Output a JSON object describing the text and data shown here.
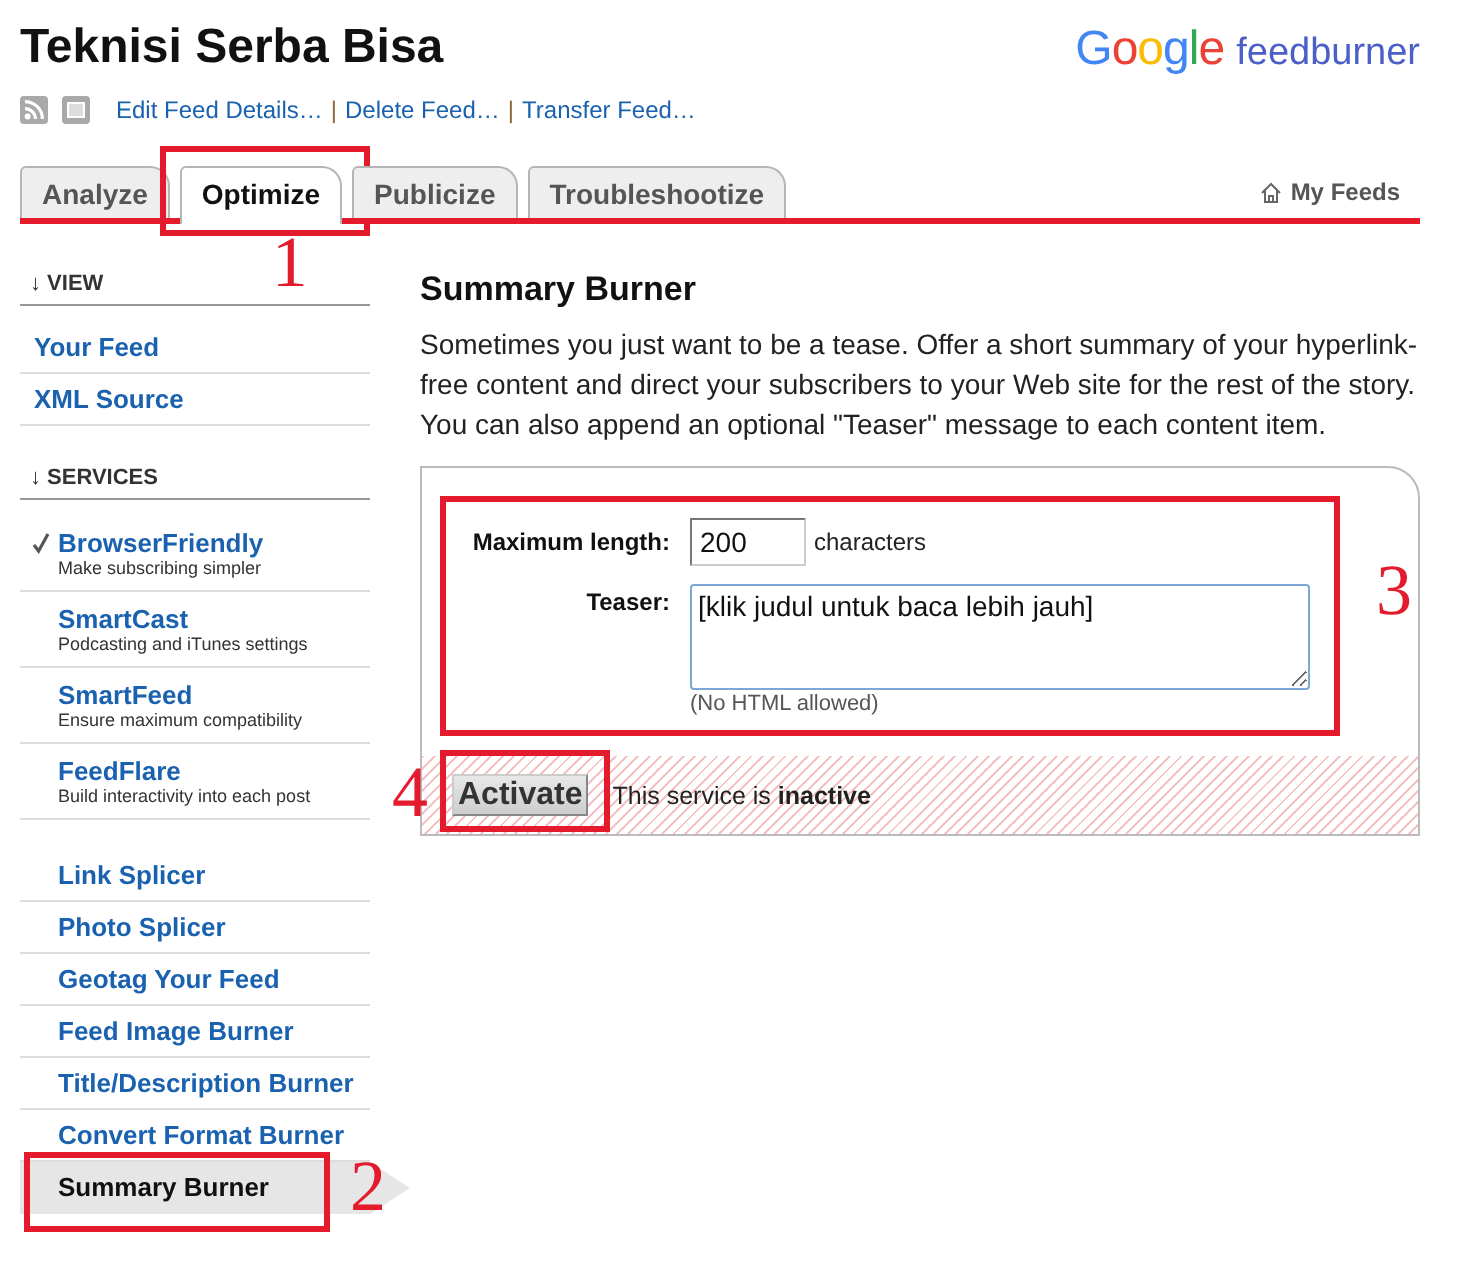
{
  "header": {
    "title": "Teknisi Serba Bisa",
    "logo": {
      "brand": "Google",
      "product": "feedburner"
    },
    "feed_links": [
      {
        "kind": "link",
        "text": "Edit Feed Details…"
      },
      {
        "kind": "separator",
        "text": "|"
      },
      {
        "kind": "link",
        "text": "Delete Feed…"
      },
      {
        "kind": "separator",
        "text": "|"
      },
      {
        "kind": "link",
        "text": "Transfer Feed…"
      }
    ]
  },
  "tabs": [
    {
      "label": "Analyze",
      "selected": false
    },
    {
      "label": "Optimize",
      "selected": true,
      "callout": "1"
    },
    {
      "label": "Publicize",
      "selected": false
    },
    {
      "label": "Troubleshootize",
      "selected": false
    }
  ],
  "my_feeds": {
    "label": "My Feeds"
  },
  "sidebar": {
    "sections": [
      {
        "kind": "view",
        "heading": "↓ VIEW",
        "items": [
          {
            "label": "Your Feed",
            "selected": false
          },
          {
            "label": "XML Source",
            "selected": false
          }
        ]
      },
      {
        "kind": "service",
        "heading": "↓ SERVICES",
        "items": [
          {
            "label": "BrowserFriendly",
            "description": "Make subscribing simpler",
            "active": true,
            "selected": false
          },
          {
            "label": "SmartCast",
            "description": "Podcasting and iTunes settings",
            "active": false,
            "selected": false
          },
          {
            "label": "SmartFeed",
            "description": "Ensure maximum compatibility",
            "active": false,
            "selected": false
          },
          {
            "label": "FeedFlare",
            "description": "Build interactivity into each post",
            "active": false,
            "selected": false
          }
        ]
      },
      {
        "kind": "service",
        "items": [
          {
            "label": "Link Splicer",
            "active": false,
            "selected": false
          },
          {
            "label": "Photo Splicer",
            "active": false,
            "selected": false
          },
          {
            "label": "Geotag Your Feed",
            "active": false,
            "selected": false
          },
          {
            "label": "Feed Image Burner",
            "active": false,
            "selected": false
          },
          {
            "label": "Title/Description Burner",
            "active": false,
            "selected": false
          },
          {
            "label": "Convert Format Burner",
            "active": false,
            "selected": false
          },
          {
            "label": "Summary Burner",
            "active": false,
            "selected": true,
            "callout": "2"
          }
        ]
      }
    ]
  },
  "main": {
    "title": "Summary Burner",
    "description": "Sometimes you just want to be a tease. Offer a short summary of your hyperlink-free content and direct your subscribers to your Web site for the rest of the story. You can also append an optional \"Teaser\" message to each content item.",
    "form": {
      "callout": "3",
      "fields": [
        {
          "kind": "input",
          "label": "Maximum length:",
          "value": "200",
          "unit": "characters"
        },
        {
          "kind": "textarea",
          "label": "Teaser:",
          "value": "[klik judul untuk baca lebih jauh]",
          "note": "(No HTML allowed)"
        }
      ]
    },
    "activation": {
      "button": "Activate",
      "status": "This service is **inactive**",
      "active": false,
      "callout": "4"
    }
  }
}
